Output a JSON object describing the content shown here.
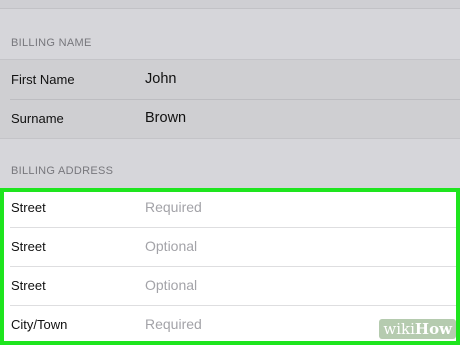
{
  "billing_name": {
    "header": "BILLING NAME",
    "rows": [
      {
        "label": "First Name",
        "value": "John"
      },
      {
        "label": "Surname",
        "value": "Brown"
      }
    ]
  },
  "billing_address": {
    "header": "BILLING ADDRESS",
    "rows": [
      {
        "label": "Street",
        "placeholder": "Required"
      },
      {
        "label": "Street",
        "placeholder": "Optional"
      },
      {
        "label": "Street",
        "placeholder": "Optional"
      },
      {
        "label": "City/Town",
        "placeholder": "Required"
      }
    ]
  },
  "watermark": {
    "part1": "wiki",
    "part2": "How"
  },
  "colors": {
    "highlight": "#1ee51e",
    "background": "#d6d6da",
    "placeholder": "#a3a3a8"
  }
}
